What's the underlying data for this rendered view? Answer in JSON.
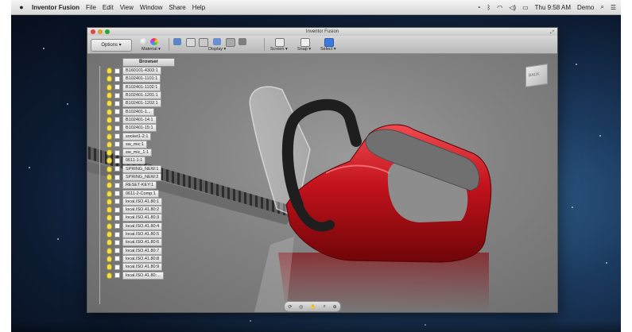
{
  "menubar": {
    "apple": "",
    "app_name": "Inventor Fusion",
    "items": [
      "File",
      "Edit",
      "View",
      "Window",
      "Share",
      "Help"
    ],
    "clock": "Thu 9:58 AM",
    "user": "Demo"
  },
  "window": {
    "title": "Inventor Fusion"
  },
  "toolbar": {
    "options_label": "Options ▾",
    "material_label": "Material ▾",
    "display_label": "Display ▾",
    "screen_label": "Screen ▾",
    "snap_label": "Snap ▾",
    "select_label": "Select ▾"
  },
  "viewcube": {
    "face": "BACK"
  },
  "browser": {
    "title": "Browser",
    "items": [
      "B160101-4303:1",
      "B102401-1101:1",
      "B102401-1102:1",
      "B102401-1201:1",
      "B102401-1202:1",
      "B102401-1...",
      "B102401-14:1",
      "B102401-15:1",
      "socket1-2:1",
      "sw_mic:1",
      "sw_mic_1:1",
      "0611-1:1",
      "SPRING_NEW:1",
      "SPRING_NEW:2",
      "RESET-KEY:1",
      "0611-2-Comp:1",
      "local.ISO.41.80:1",
      "local.ISO.41.80:2",
      "local.ISO.41.80:3",
      "local.ISO.41.80:4",
      "local.ISO.41.80:5",
      "local.ISO.41.80:6",
      "local.ISO.41.80:7",
      "local.ISO.41.80:8",
      "local.ISO.41.80:9",
      "local.ISO.41.80:..."
    ]
  },
  "colors": {
    "model_red": "#c2121c",
    "handle_black": "#1e1e1e",
    "grip_gray": "#707070",
    "viewport_gray": "#8a8a8a"
  }
}
